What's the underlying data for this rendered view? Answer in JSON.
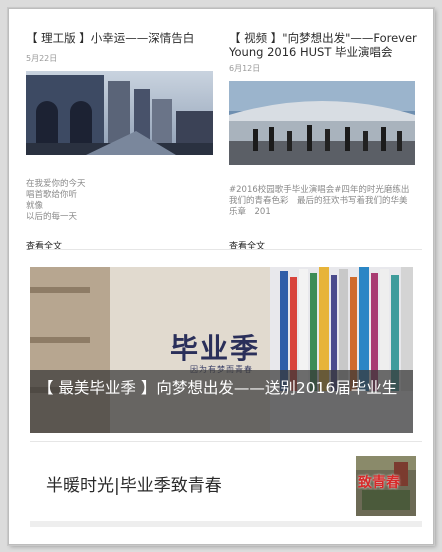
{
  "articles": [
    {
      "title": "【 理工版 】小幸运——深情告白",
      "date": "5月22日",
      "excerpt": [
        "在我爱你的今天",
        "唱首歌给你听",
        "就像",
        "以后的每一天"
      ],
      "more": "查看全文"
    },
    {
      "title": "【 视频 】\"向梦想出发\"——Forever Young 2016 HUST 毕业演唱会",
      "date": "6月12日",
      "excerpt": [
        "#2016校园歌手毕业演唱会#四年的时光磨练出",
        "我们的青春色彩　最后的狂欢书写着我们的华美",
        "乐章　201"
      ],
      "more": "查看全文"
    }
  ],
  "banner": {
    "stamp_text": "毕业季",
    "stamp_sub": "因为有梦而青春",
    "caption": "【 最美毕业季 】向梦想出发——送别2016届毕业生"
  },
  "row_item": {
    "title": "半暖时光|毕业季致青春",
    "thumb_text": "致青春"
  }
}
